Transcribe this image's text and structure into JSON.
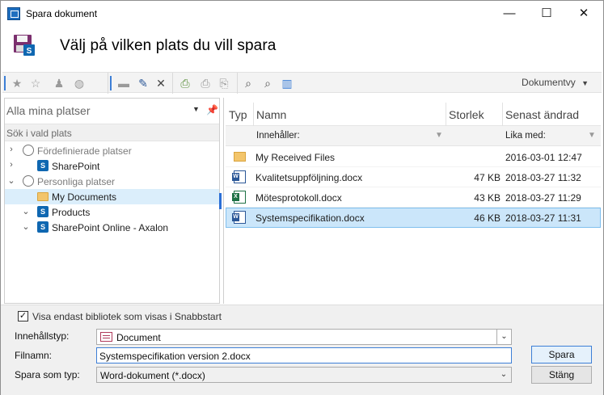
{
  "window": {
    "title": "Spara dokument",
    "minimize": "—",
    "maximize": "☐",
    "close": "✕"
  },
  "header": {
    "title": "Välj på vilken plats du vill spara"
  },
  "toolbar": {
    "view_label": "Dokumentvy"
  },
  "locations": {
    "selector": "Alla mina platser",
    "search_label": "Sök i vald plats",
    "tree": [
      {
        "label": "Fördefinierade platser",
        "icon": "globe-icon",
        "expanded": false,
        "dim": true
      },
      {
        "label": "SharePoint",
        "icon": "sharepoint-icon",
        "expanded": false,
        "dim": false
      },
      {
        "label": "Personliga platser",
        "icon": "person-globe-icon",
        "expanded": true,
        "dim": true
      },
      {
        "label": "My Documents",
        "icon": "folder-icon",
        "selected": true,
        "dim": false
      },
      {
        "label": "Products",
        "icon": "sharepoint-icon",
        "expanded": true,
        "dim": false
      },
      {
        "label": "SharePoint Online - Axalon",
        "icon": "sharepoint-icon",
        "expanded": true,
        "dim": false
      }
    ]
  },
  "files": {
    "columns": {
      "type": "Typ",
      "name": "Namn",
      "size": "Storlek",
      "modified": "Senast ändrad"
    },
    "filters": {
      "name": "Innehåller:",
      "modified": "Lika med:"
    },
    "rows": [
      {
        "icon": "folder-icon",
        "name": "My Received Files",
        "size": "",
        "modified": "2016-03-01 12:47",
        "selected": false
      },
      {
        "icon": "word-icon",
        "name": "Kvalitetsuppföljning.docx",
        "size": "47 KB",
        "modified": "2018-03-27 11:32",
        "selected": false
      },
      {
        "icon": "excel-icon",
        "name": "Mötesprotokoll.docx",
        "size": "43 KB",
        "modified": "2018-03-27 11:29",
        "selected": false
      },
      {
        "icon": "word-icon",
        "name": "Systemspecifikation.docx",
        "size": "46 KB",
        "modified": "2018-03-27 11:31",
        "selected": true
      }
    ]
  },
  "bottom": {
    "checkbox_label": "Visa endast bibliotek som visas i Snabbstart",
    "checkbox_checked": "✓",
    "content_type_label": "Innehållstyp:",
    "content_type_value": "Document",
    "filename_label": "Filnamn:",
    "filename_value": "Systemspecifikation version 2.docx",
    "save_as_type_label": "Spara som typ:",
    "save_as_type_value": "Word-dokument (*.docx)",
    "save_button": "Spara",
    "close_button": "Stäng"
  },
  "colors": {
    "accent": "#3d7fd6",
    "selection": "#cbe6fa",
    "sharepoint": "#0f67b1"
  }
}
